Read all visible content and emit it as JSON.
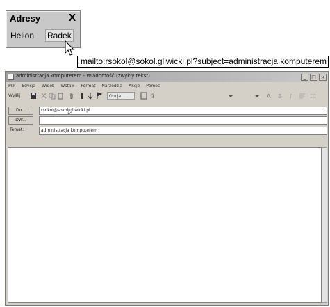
{
  "address_panel": {
    "title": "Adresy",
    "close": "X",
    "items": [
      {
        "label": "Helion"
      },
      {
        "label": "Radek"
      }
    ]
  },
  "tooltip": {
    "text": "mailto:rsokol@sokol.gliwicki.pl?subject=administracja komputerem"
  },
  "message_window": {
    "title": "administracja komputerem - Wiadomość (zwykły tekst)",
    "window_buttons": [
      "_",
      "□",
      "×"
    ],
    "menu": [
      "Plik",
      "Edycja",
      "Widok",
      "Wstaw",
      "Format",
      "Narzędzia",
      "Akcje",
      "Pomoc"
    ],
    "toolbar": {
      "send": "Wyślij",
      "options": "Opcje..."
    },
    "to_button": "Do...",
    "to_value": "rsokol@sokol.gliwicki.pl",
    "cc_button": "DW...",
    "cc_value": "",
    "subject_label": "Temat:",
    "subject_value": "administracja komputerem"
  },
  "colors": {
    "window_bg": "#d4d0c8",
    "panel_bg": "#c8c8c8",
    "tooltip_bg": "#ffffff"
  }
}
